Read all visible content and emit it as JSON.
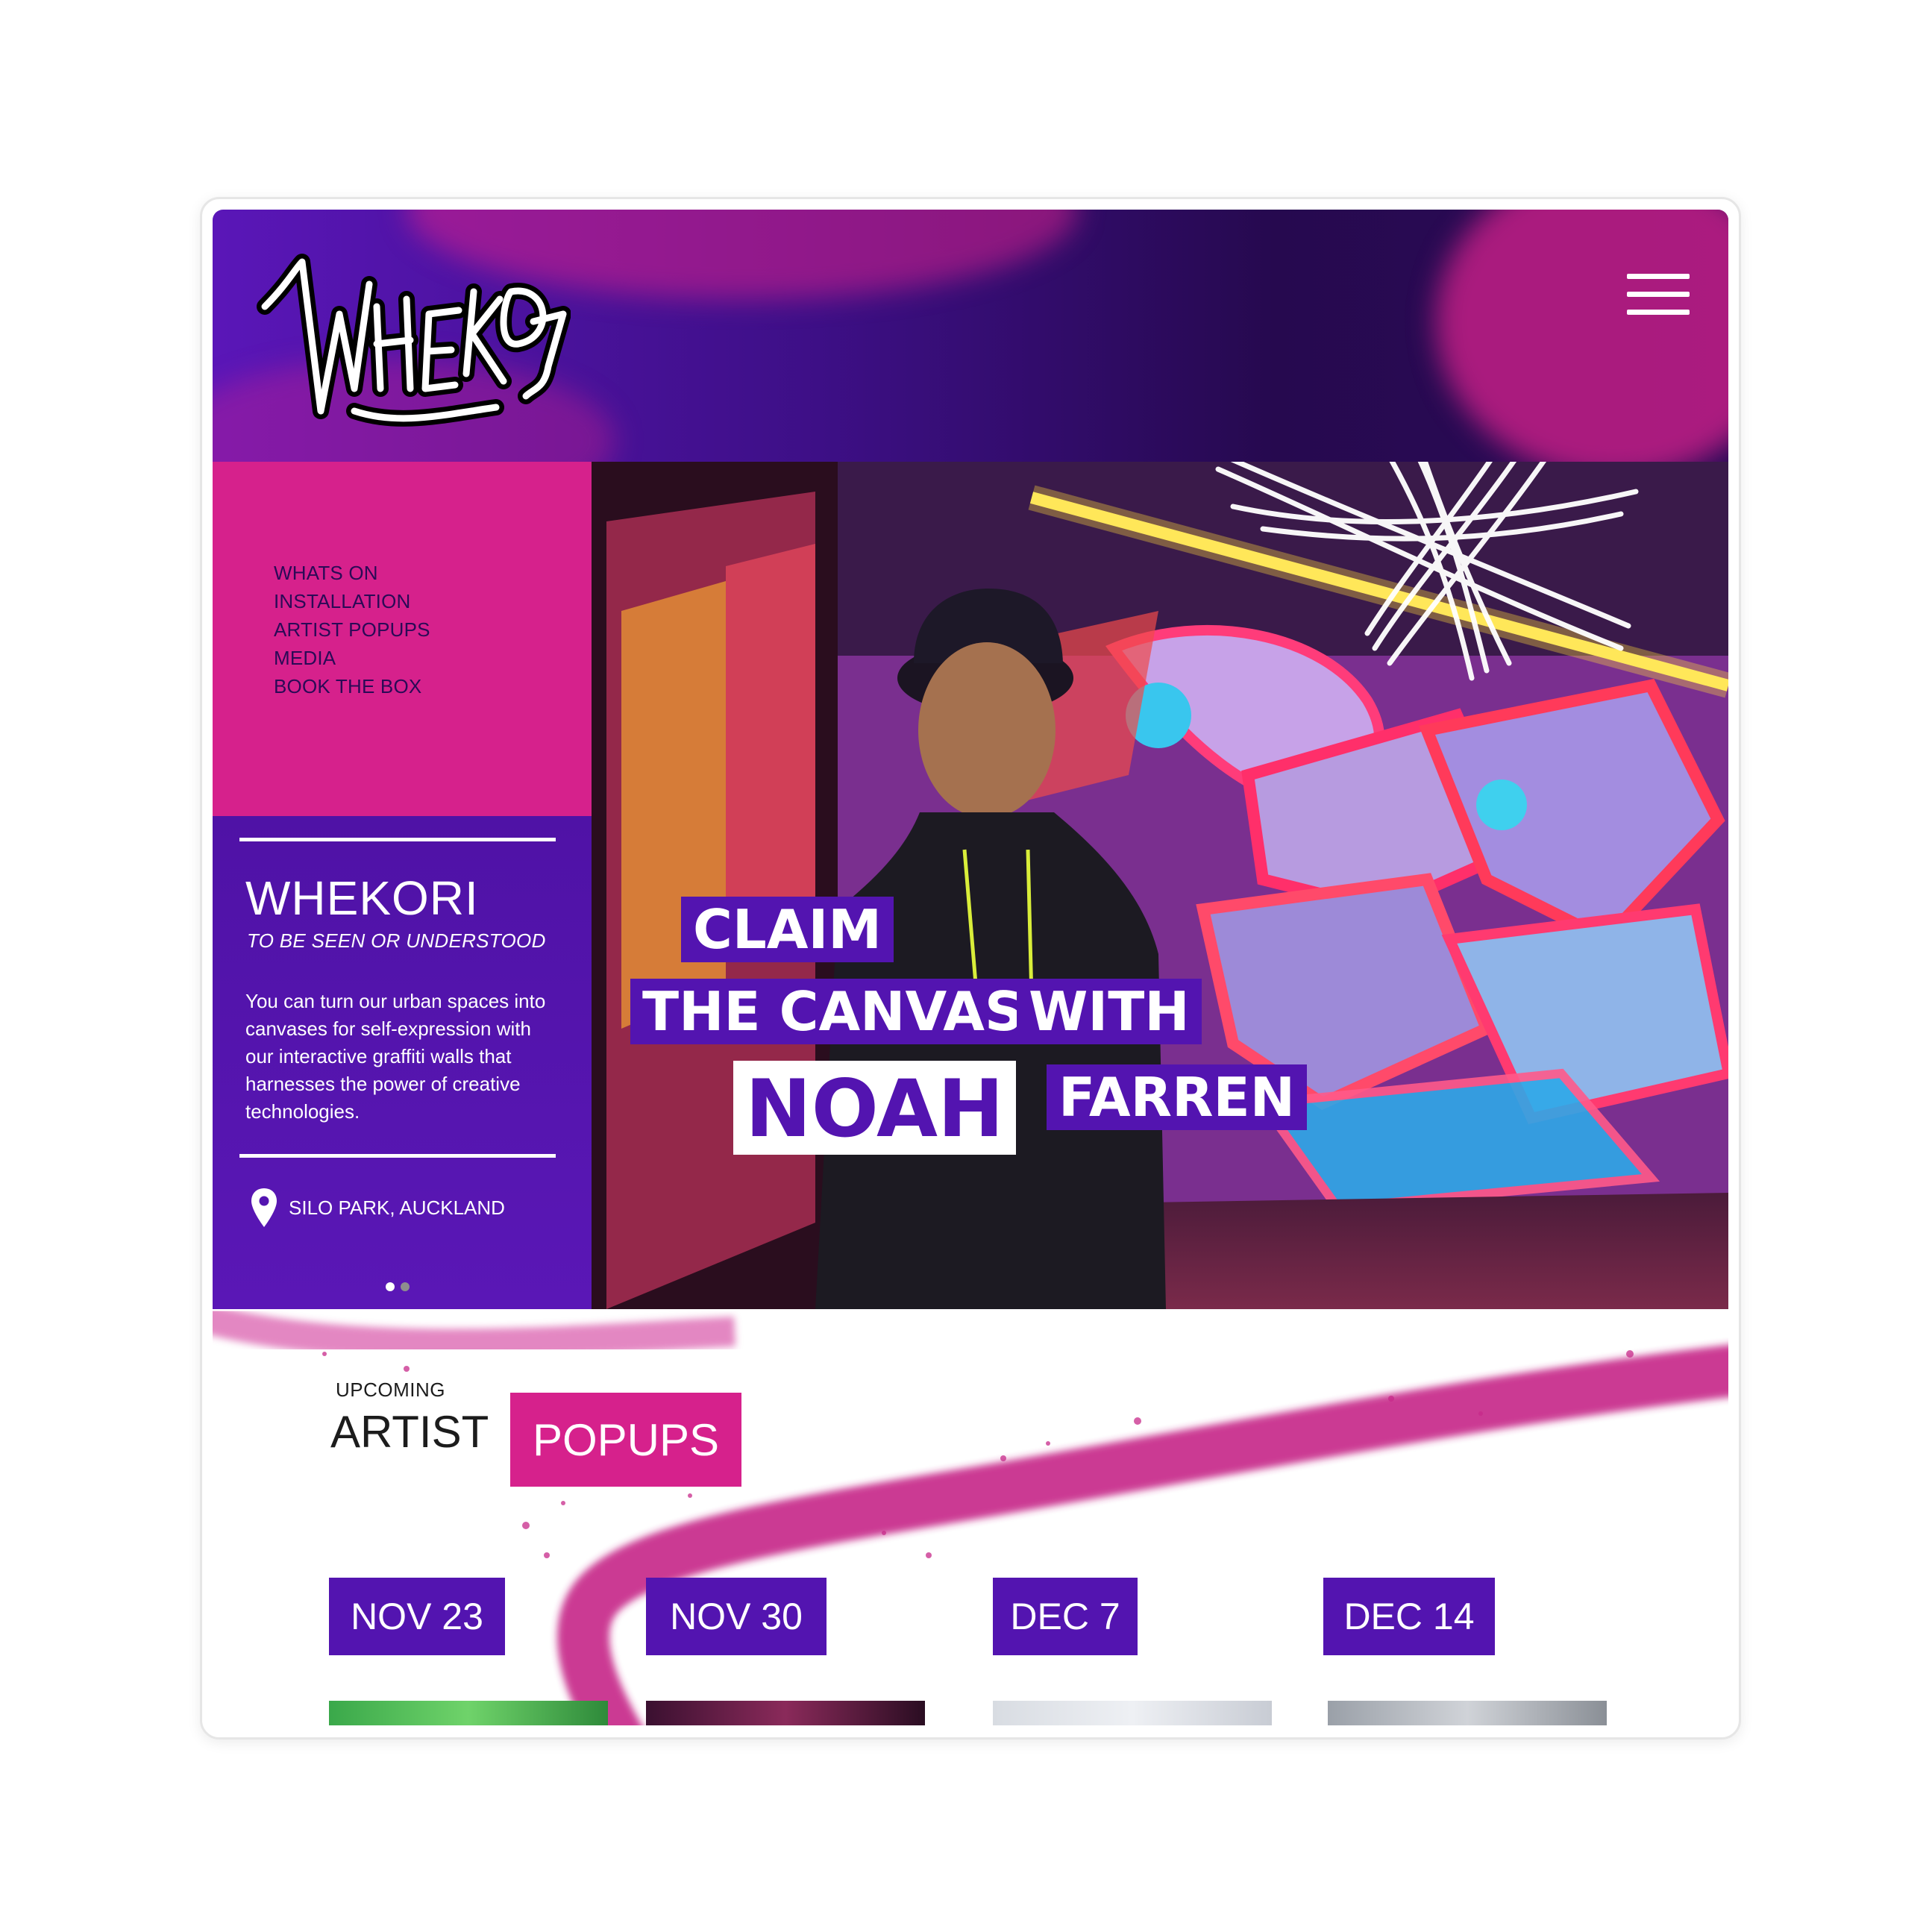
{
  "brand": {
    "logo_text": "WHEKORI",
    "title": "WHEKORI",
    "subtitle": "TO BE SEEN OR UNDERSTOOD",
    "description": "You can turn our urban spaces into canvases for self-expression with our interactive graffiti walls that harnesses the power of creative technologies.",
    "location": "SILO PARK, AUCKLAND"
  },
  "nav": {
    "items": [
      {
        "label": "WHATS ON"
      },
      {
        "label": "INSTALLATION"
      },
      {
        "label": "ARTIST POPUPS"
      },
      {
        "label": "MEDIA"
      },
      {
        "label": "BOOK THE BOX"
      }
    ]
  },
  "hero": {
    "line1": "CLAIM",
    "line2a": "THE CANVAS",
    "line2b": "WITH",
    "line3a": "NOAH",
    "line3b": "FARREN"
  },
  "carousel": {
    "slide_count": 2,
    "active_index": 0
  },
  "popups": {
    "eyebrow": "UPCOMING",
    "title_a": "ARTIST",
    "title_b": "POPUPS",
    "dates": [
      {
        "label": "NOV 23"
      },
      {
        "label": "NOV 30"
      },
      {
        "label": "DEC 7"
      },
      {
        "label": "DEC 14"
      }
    ]
  },
  "colors": {
    "brand_purple": "#5314b0",
    "brand_pink": "#d6218c",
    "header_dark": "#26094f"
  },
  "icons": {
    "menu": "hamburger-menu-icon",
    "location": "map-pin-icon"
  }
}
